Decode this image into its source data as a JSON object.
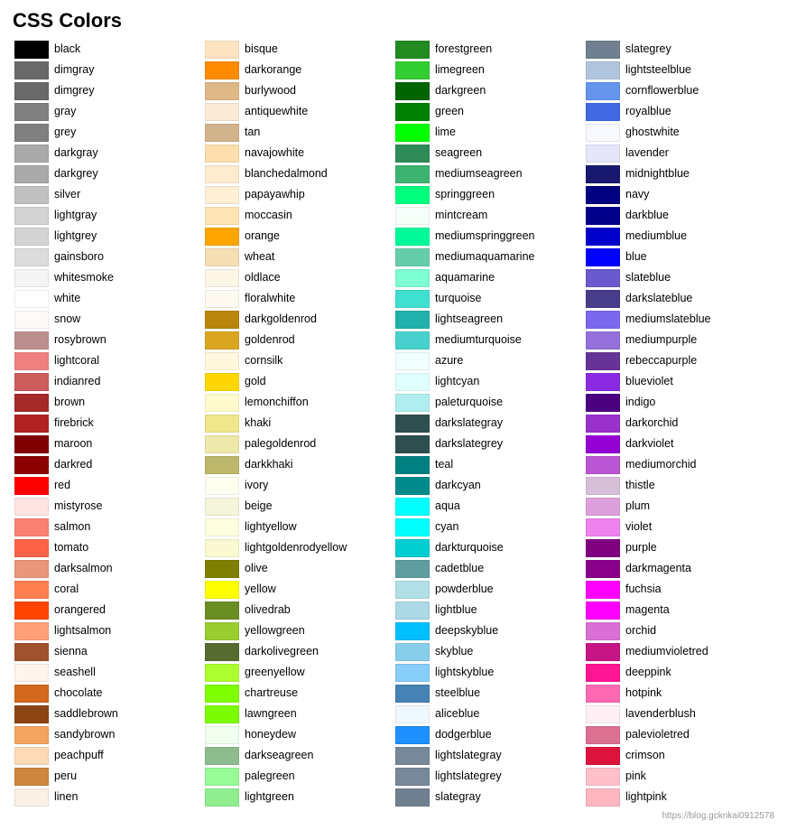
{
  "title": "CSS Colors",
  "columns": [
    [
      {
        "name": "black",
        "hex": "#000000"
      },
      {
        "name": "dimgray",
        "hex": "#696969"
      },
      {
        "name": "dimgrey",
        "hex": "#696969"
      },
      {
        "name": "gray",
        "hex": "#808080"
      },
      {
        "name": "grey",
        "hex": "#808080"
      },
      {
        "name": "darkgray",
        "hex": "#a9a9a9"
      },
      {
        "name": "darkgrey",
        "hex": "#a9a9a9"
      },
      {
        "name": "silver",
        "hex": "#c0c0c0"
      },
      {
        "name": "lightgray",
        "hex": "#d3d3d3"
      },
      {
        "name": "lightgrey",
        "hex": "#d3d3d3"
      },
      {
        "name": "gainsboro",
        "hex": "#dcdcdc"
      },
      {
        "name": "whitesmoke",
        "hex": "#f5f5f5"
      },
      {
        "name": "white",
        "hex": "#ffffff"
      },
      {
        "name": "snow",
        "hex": "#fffafa"
      },
      {
        "name": "rosybrown",
        "hex": "#bc8f8f"
      },
      {
        "name": "lightcoral",
        "hex": "#f08080"
      },
      {
        "name": "indianred",
        "hex": "#cd5c5c"
      },
      {
        "name": "brown",
        "hex": "#a52a2a"
      },
      {
        "name": "firebrick",
        "hex": "#b22222"
      },
      {
        "name": "maroon",
        "hex": "#800000"
      },
      {
        "name": "darkred",
        "hex": "#8b0000"
      },
      {
        "name": "red",
        "hex": "#ff0000"
      },
      {
        "name": "mistyrose",
        "hex": "#ffe4e1"
      },
      {
        "name": "salmon",
        "hex": "#fa8072"
      },
      {
        "name": "tomato",
        "hex": "#ff6347"
      },
      {
        "name": "darksalmon",
        "hex": "#e9967a"
      },
      {
        "name": "coral",
        "hex": "#ff7f50"
      },
      {
        "name": "orangered",
        "hex": "#ff4500"
      },
      {
        "name": "lightsalmon",
        "hex": "#ffa07a"
      },
      {
        "name": "sienna",
        "hex": "#a0522d"
      },
      {
        "name": "seashell",
        "hex": "#fff5ee"
      },
      {
        "name": "chocolate",
        "hex": "#d2691e"
      },
      {
        "name": "saddlebrown",
        "hex": "#8b4513"
      },
      {
        "name": "sandybrown",
        "hex": "#f4a460"
      },
      {
        "name": "peachpuff",
        "hex": "#ffdab9"
      },
      {
        "name": "peru",
        "hex": "#cd853f"
      },
      {
        "name": "linen",
        "hex": "#faf0e6"
      }
    ],
    [
      {
        "name": "bisque",
        "hex": "#ffe4c4"
      },
      {
        "name": "darkorange",
        "hex": "#ff8c00"
      },
      {
        "name": "burlywood",
        "hex": "#deb887"
      },
      {
        "name": "antiquewhite",
        "hex": "#faebd7"
      },
      {
        "name": "tan",
        "hex": "#d2b48c"
      },
      {
        "name": "navajowhite",
        "hex": "#ffdead"
      },
      {
        "name": "blanchedalmond",
        "hex": "#ffebcd"
      },
      {
        "name": "papayawhip",
        "hex": "#ffefd5"
      },
      {
        "name": "moccasin",
        "hex": "#ffe4b5"
      },
      {
        "name": "orange",
        "hex": "#ffa500"
      },
      {
        "name": "wheat",
        "hex": "#f5deb3"
      },
      {
        "name": "oldlace",
        "hex": "#fdf5e6"
      },
      {
        "name": "floralwhite",
        "hex": "#fffaf0"
      },
      {
        "name": "darkgoldenrod",
        "hex": "#b8860b"
      },
      {
        "name": "goldenrod",
        "hex": "#daa520"
      },
      {
        "name": "cornsilk",
        "hex": "#fff8dc"
      },
      {
        "name": "gold",
        "hex": "#ffd700"
      },
      {
        "name": "lemonchiffon",
        "hex": "#fffacd"
      },
      {
        "name": "khaki",
        "hex": "#f0e68c"
      },
      {
        "name": "palegoldenrod",
        "hex": "#eee8aa"
      },
      {
        "name": "darkkhaki",
        "hex": "#bdb76b"
      },
      {
        "name": "ivory",
        "hex": "#fffff0"
      },
      {
        "name": "beige",
        "hex": "#f5f5dc"
      },
      {
        "name": "lightyellow",
        "hex": "#ffffe0"
      },
      {
        "name": "lightgoldenrodyellow",
        "hex": "#fafad2"
      },
      {
        "name": "olive",
        "hex": "#808000"
      },
      {
        "name": "yellow",
        "hex": "#ffff00"
      },
      {
        "name": "olivedrab",
        "hex": "#6b8e23"
      },
      {
        "name": "yellowgreen",
        "hex": "#9acd32"
      },
      {
        "name": "darkolivegreen",
        "hex": "#556b2f"
      },
      {
        "name": "greenyellow",
        "hex": "#adff2f"
      },
      {
        "name": "chartreuse",
        "hex": "#7fff00"
      },
      {
        "name": "lawngreen",
        "hex": "#7cfc00"
      },
      {
        "name": "honeydew",
        "hex": "#f0fff0"
      },
      {
        "name": "darkseagreen",
        "hex": "#8fbc8f"
      },
      {
        "name": "palegreen",
        "hex": "#98fb98"
      },
      {
        "name": "lightgreen",
        "hex": "#90ee90"
      }
    ],
    [
      {
        "name": "forestgreen",
        "hex": "#228b22"
      },
      {
        "name": "limegreen",
        "hex": "#32cd32"
      },
      {
        "name": "darkgreen",
        "hex": "#006400"
      },
      {
        "name": "green",
        "hex": "#008000"
      },
      {
        "name": "lime",
        "hex": "#00ff00"
      },
      {
        "name": "seagreen",
        "hex": "#2e8b57"
      },
      {
        "name": "mediumseagreen",
        "hex": "#3cb371"
      },
      {
        "name": "springgreen",
        "hex": "#00ff7f"
      },
      {
        "name": "mintcream",
        "hex": "#f5fffa"
      },
      {
        "name": "mediumspringgreen",
        "hex": "#00fa9a"
      },
      {
        "name": "mediumaquamarine",
        "hex": "#66cdaa"
      },
      {
        "name": "aquamarine",
        "hex": "#7fffd4"
      },
      {
        "name": "turquoise",
        "hex": "#40e0d0"
      },
      {
        "name": "lightseagreen",
        "hex": "#20b2aa"
      },
      {
        "name": "mediumturquoise",
        "hex": "#48d1cc"
      },
      {
        "name": "azure",
        "hex": "#f0ffff"
      },
      {
        "name": "lightcyan",
        "hex": "#e0ffff"
      },
      {
        "name": "paleturquoise",
        "hex": "#afeeee"
      },
      {
        "name": "darkslategray",
        "hex": "#2f4f4f"
      },
      {
        "name": "darkslategrey",
        "hex": "#2f4f4f"
      },
      {
        "name": "teal",
        "hex": "#008080"
      },
      {
        "name": "darkcyan",
        "hex": "#008b8b"
      },
      {
        "name": "aqua",
        "hex": "#00ffff"
      },
      {
        "name": "cyan",
        "hex": "#00ffff"
      },
      {
        "name": "darkturquoise",
        "hex": "#00ced1"
      },
      {
        "name": "cadetblue",
        "hex": "#5f9ea0"
      },
      {
        "name": "powderblue",
        "hex": "#b0e0e6"
      },
      {
        "name": "lightblue",
        "hex": "#add8e6"
      },
      {
        "name": "deepskyblue",
        "hex": "#00bfff"
      },
      {
        "name": "skyblue",
        "hex": "#87ceeb"
      },
      {
        "name": "lightskyblue",
        "hex": "#87cefa"
      },
      {
        "name": "steelblue",
        "hex": "#4682b4"
      },
      {
        "name": "aliceblue",
        "hex": "#f0f8ff"
      },
      {
        "name": "dodgerblue",
        "hex": "#1e90ff"
      },
      {
        "name": "lightslategray",
        "hex": "#778899"
      },
      {
        "name": "lightslategrey",
        "hex": "#778899"
      },
      {
        "name": "slategray",
        "hex": "#708090"
      }
    ],
    [
      {
        "name": "slategrey",
        "hex": "#708090"
      },
      {
        "name": "lightsteelblue",
        "hex": "#b0c4de"
      },
      {
        "name": "cornflowerblue",
        "hex": "#6495ed"
      },
      {
        "name": "royalblue",
        "hex": "#4169e1"
      },
      {
        "name": "ghostwhite",
        "hex": "#f8f8ff"
      },
      {
        "name": "lavender",
        "hex": "#e6e6fa"
      },
      {
        "name": "midnightblue",
        "hex": "#191970"
      },
      {
        "name": "navy",
        "hex": "#000080"
      },
      {
        "name": "darkblue",
        "hex": "#00008b"
      },
      {
        "name": "mediumblue",
        "hex": "#0000cd"
      },
      {
        "name": "blue",
        "hex": "#0000ff"
      },
      {
        "name": "slateblue",
        "hex": "#6a5acd"
      },
      {
        "name": "darkslateblue",
        "hex": "#483d8b"
      },
      {
        "name": "mediumslateblue",
        "hex": "#7b68ee"
      },
      {
        "name": "mediumpurple",
        "hex": "#9370db"
      },
      {
        "name": "rebeccapurple",
        "hex": "#663399"
      },
      {
        "name": "blueviolet",
        "hex": "#8a2be2"
      },
      {
        "name": "indigo",
        "hex": "#4b0082"
      },
      {
        "name": "darkorchid",
        "hex": "#9932cc"
      },
      {
        "name": "darkviolet",
        "hex": "#9400d3"
      },
      {
        "name": "mediumorchid",
        "hex": "#ba55d3"
      },
      {
        "name": "thistle",
        "hex": "#d8bfd8"
      },
      {
        "name": "plum",
        "hex": "#dda0dd"
      },
      {
        "name": "violet",
        "hex": "#ee82ee"
      },
      {
        "name": "purple",
        "hex": "#800080"
      },
      {
        "name": "darkmagenta",
        "hex": "#8b008b"
      },
      {
        "name": "fuchsia",
        "hex": "#ff00ff"
      },
      {
        "name": "magenta",
        "hex": "#ff00ff"
      },
      {
        "name": "orchid",
        "hex": "#da70d6"
      },
      {
        "name": "mediumvioletred",
        "hex": "#c71585"
      },
      {
        "name": "deeppink",
        "hex": "#ff1493"
      },
      {
        "name": "hotpink",
        "hex": "#ff69b4"
      },
      {
        "name": "lavenderblush",
        "hex": "#fff0f5"
      },
      {
        "name": "palevioletred",
        "hex": "#db7093"
      },
      {
        "name": "crimson",
        "hex": "#dc143c"
      },
      {
        "name": "pink",
        "hex": "#ffc0cb"
      },
      {
        "name": "lightpink",
        "hex": "#ffb6c1"
      }
    ]
  ],
  "watermark": "https://blog.gcknkai0912578"
}
